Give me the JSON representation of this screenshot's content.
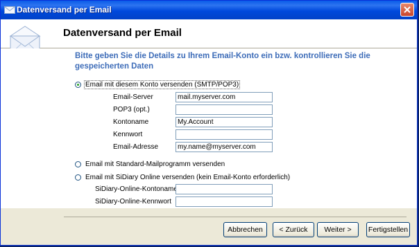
{
  "window": {
    "title": "Datenversand per Email"
  },
  "header": {
    "title": "Datenversand per Email"
  },
  "intro": "Bitte geben Sie die Details zu Ihrem Email-Konto ein bzw. kontrollieren Sie die gespeicherten Daten",
  "options": {
    "account": {
      "label": "Email mit diesem Konto versenden (SMTP/POP3)",
      "checked": true
    },
    "standard": {
      "label": "Email mit Standard-Mailprogramm versenden",
      "checked": false
    },
    "online": {
      "label": "Email mit SiDiary Online versenden (kein Email-Konto erforderlich)",
      "checked": false
    }
  },
  "account_fields": {
    "server": {
      "label": "Email-Server",
      "value": "mail.myserver.com"
    },
    "pop3": {
      "label": "POP3 (opt.)",
      "value": ""
    },
    "account": {
      "label": "Kontoname",
      "value": "My.Account"
    },
    "password": {
      "label": "Kennwort",
      "value": ""
    },
    "email": {
      "label": "Email-Adresse",
      "value": "my.name@myserver.com"
    }
  },
  "online_fields": {
    "account": {
      "label": "SiDiary-Online-Kontoname",
      "value": ""
    },
    "password": {
      "label": "SiDiary-Online-Kennwort",
      "value": ""
    }
  },
  "buttons": {
    "cancel": "Abbrechen",
    "back": "< Zurück",
    "next": "Weiter >",
    "finish": "Fertigstellen"
  },
  "icons": {
    "title": "envelope-icon",
    "header": "envelope-icon",
    "close": "close-icon"
  },
  "colors": {
    "titlebar": "#0a5ce8",
    "accent_text": "#3d6cb8",
    "close": "#c8442a"
  }
}
